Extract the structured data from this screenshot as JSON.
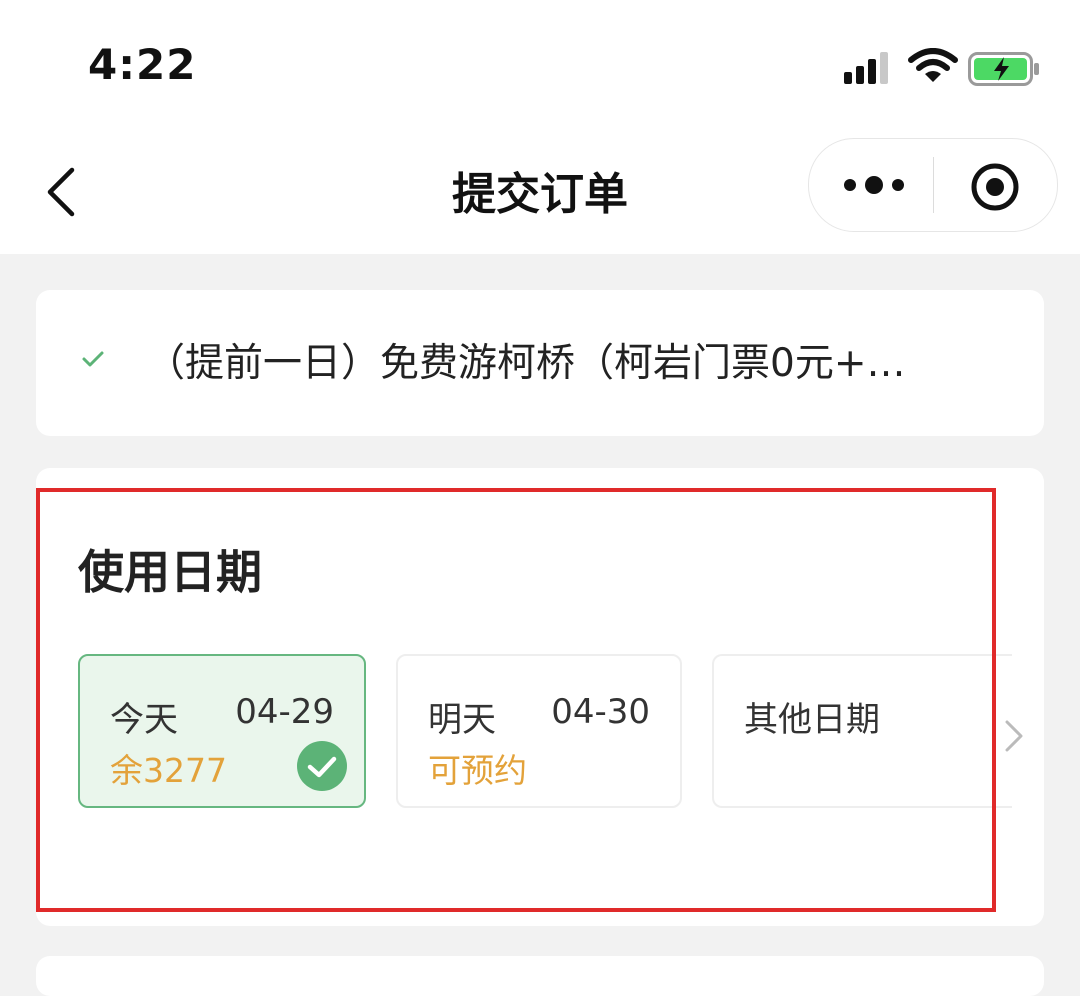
{
  "status_bar": {
    "time": "4:22",
    "signal_icon": "signal-bars-icon",
    "wifi_icon": "wifi-icon",
    "battery_icon": "battery-charging-icon",
    "battery_color": "#4cd964"
  },
  "nav": {
    "title": "提交订单",
    "back_icon": "chevron-left-icon",
    "more_icon": "more-dots-icon",
    "close_icon": "target-circle-icon"
  },
  "product": {
    "check_icon": "check-icon",
    "name": "（提前一日）免费游柯桥（柯岩门票0元+…"
  },
  "date_section": {
    "title": "使用日期",
    "options": [
      {
        "day": "今天",
        "date": "04-29",
        "status": "余3277",
        "selected": true
      },
      {
        "day": "明天",
        "date": "04-30",
        "status": "可预约",
        "selected": false
      },
      {
        "label": "其他日期",
        "icon": "chevron-right-icon"
      }
    ]
  },
  "colors": {
    "accent_green": "#5cb377",
    "status_orange": "#e3a23a",
    "highlight_red": "#e02a2a",
    "selected_bg": "#eaf6ec"
  }
}
